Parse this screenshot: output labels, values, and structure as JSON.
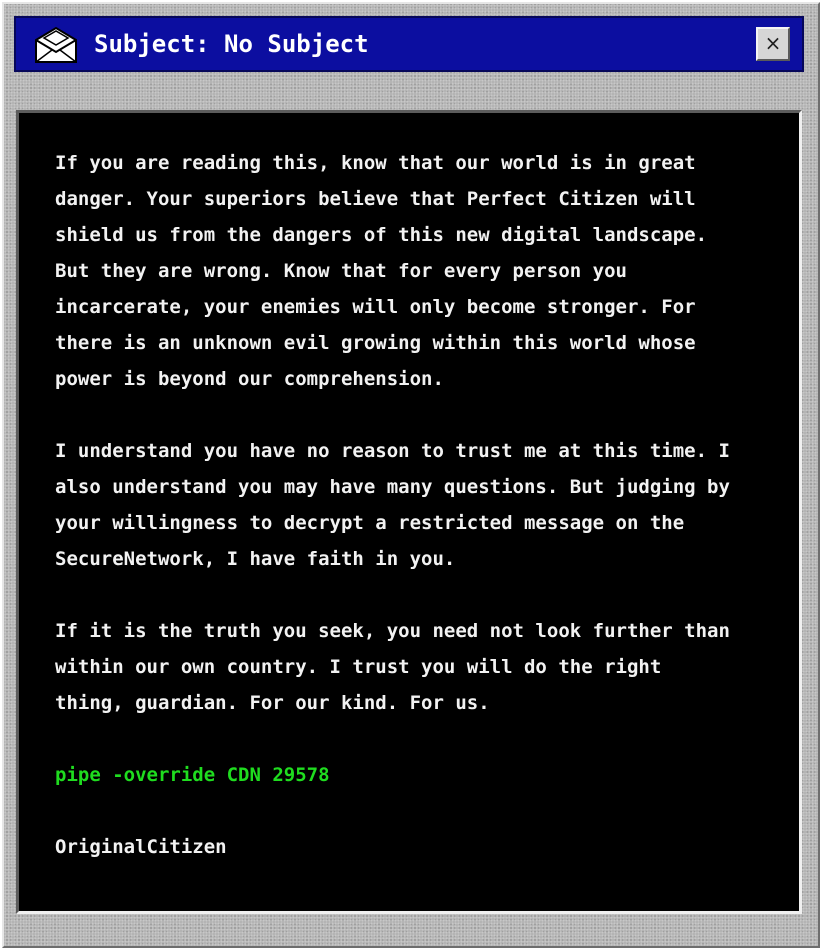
{
  "window": {
    "title": "Subject: No Subject",
    "close_label": "×",
    "icon": "envelope-icon"
  },
  "message": {
    "paragraphs": [
      "If you are reading this, know that our world is in great\ndanger. Your superiors believe that Perfect Citizen will\nshield us from the dangers of this new digital landscape.\nBut they are wrong. Know that for every person you\nincarcerate, your enemies will only become stronger. For\nthere is an unknown evil growing within this world whose\npower is beyond our comprehension.",
      "I understand you have no reason to trust me at this time. I\nalso understand you may have many questions. But judging by\nyour willingness to decrypt a restricted message on the\nSecureNetwork, I have faith in you.",
      "If it is the truth you seek, you need not look further than\nwithin our own country. I trust you will do the right\nthing, guardian. For our kind. For us."
    ],
    "command": "pipe -override CDN 29578",
    "signature": "OriginalCitizen"
  },
  "colors": {
    "titlebar": "#0c0ea0",
    "panel_bg": "#000000",
    "text": "#f2f2f2",
    "command": "#1fdc1f"
  }
}
